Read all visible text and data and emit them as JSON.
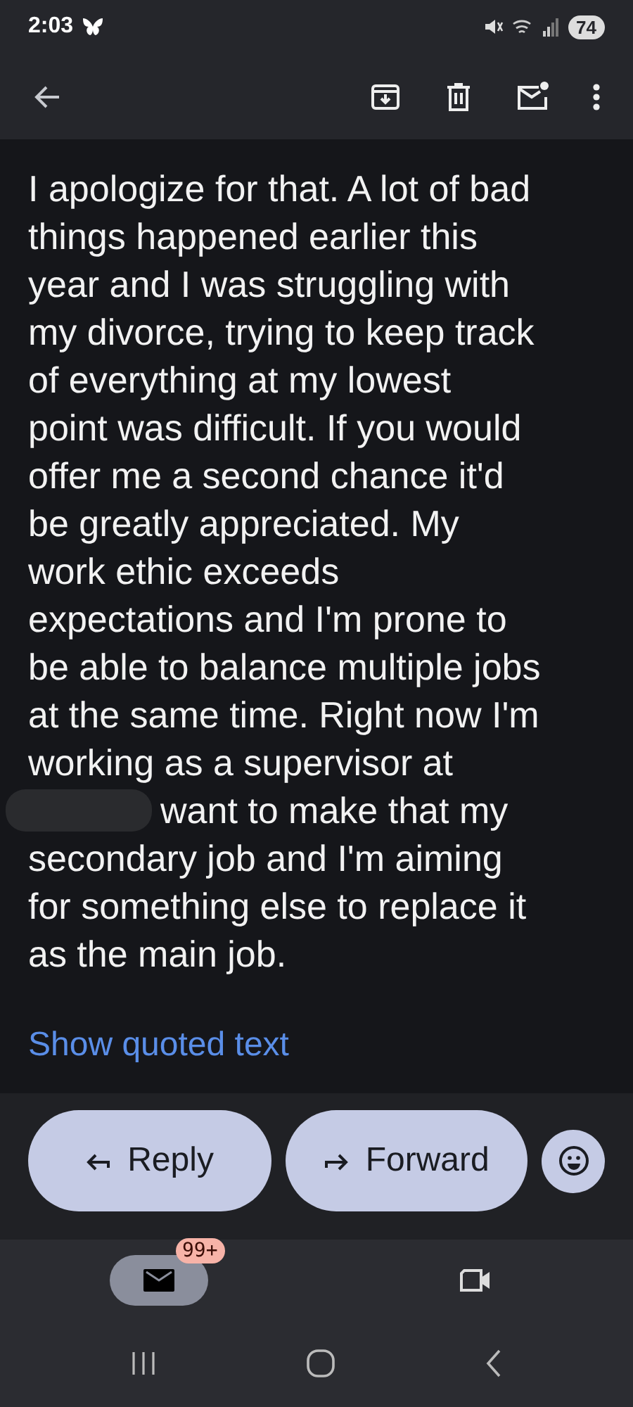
{
  "status_bar": {
    "time": "2:03",
    "battery": "74"
  },
  "message": {
    "lines_before_redaction": [
      "I apologize for that. A lot of bad",
      "things happened earlier this",
      "year and I was struggling with",
      "my divorce, trying to keep track",
      "of everything at my lowest",
      "point was difficult. If you would",
      "offer me a second chance it'd",
      "be greatly appreciated. My",
      "work ethic exceeds",
      "expectations and I'm prone to",
      "be able to balance multiple jobs",
      "at the same time. Right now I'm",
      "working as a supervisor at"
    ],
    "text_after_redaction": "want to make that my",
    "lines_after_redaction": [
      "secondary job and I'm aiming",
      "for something else to replace it",
      "as the main job."
    ],
    "show_quoted": "Show quoted text"
  },
  "actions": [
    {
      "kind": "reply",
      "label": "Reply"
    },
    {
      "kind": "forward",
      "label": "Forward"
    },
    {
      "kind": "emoji"
    }
  ],
  "bottom_nav": [
    {
      "kind": "mail",
      "selected": true,
      "badge": "99+"
    },
    {
      "kind": "video",
      "selected": false
    }
  ]
}
